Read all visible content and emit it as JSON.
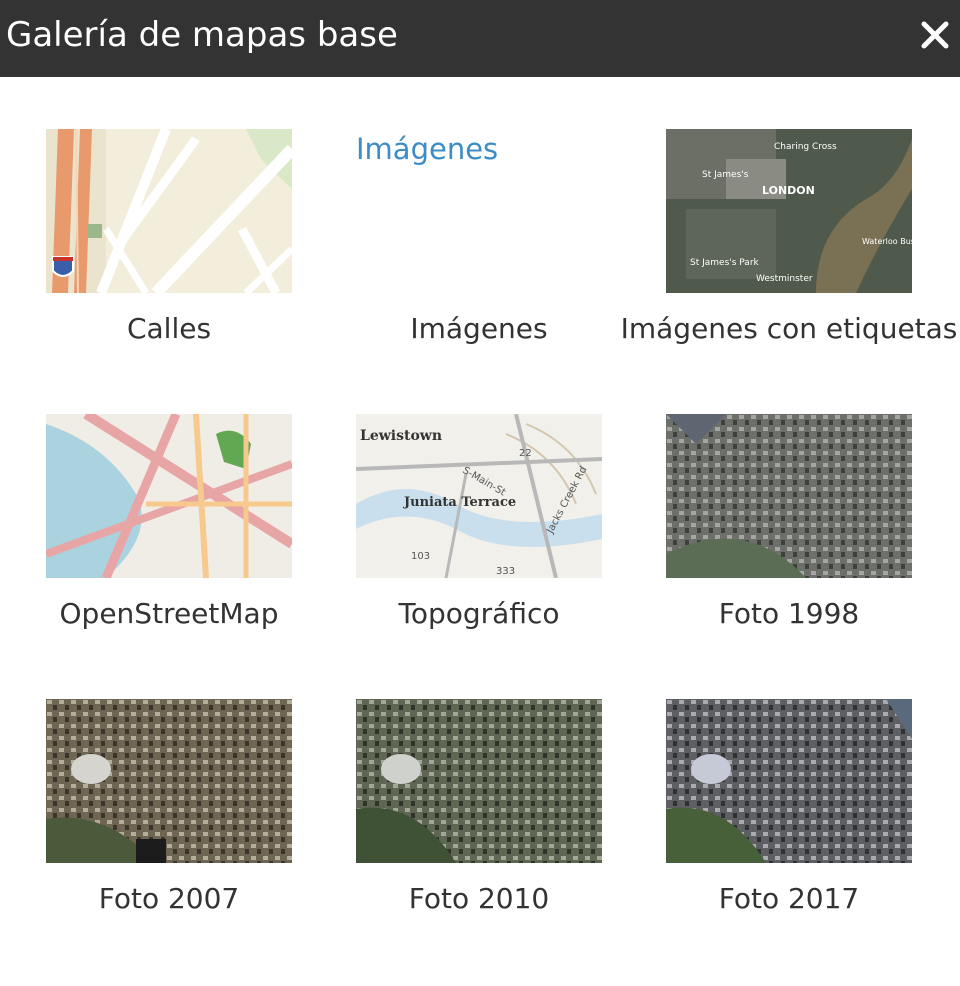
{
  "dialog": {
    "title": "Galería de mapas base",
    "close_icon": "close-icon"
  },
  "basemaps": [
    {
      "label": "Calles",
      "thumbnail": "streets-map"
    },
    {
      "label": "Imágenes",
      "thumbnail_alt": "Imágenes",
      "thumbnail_missing": true
    },
    {
      "label": "Imágenes con etiquetas",
      "thumbnail": "imagery-labels-map",
      "thumb_labels": [
        "Charing Cross",
        "St James's",
        "LONDON",
        "Waterloo Business Centre",
        "St James's Park",
        "Westminster"
      ]
    },
    {
      "label": "OpenStreetMap",
      "thumbnail": "osm-map"
    },
    {
      "label": "Topográfico",
      "thumbnail": "topo-map",
      "thumb_labels": [
        "Lewistown",
        "Juniata Terrace",
        "S-Main-St",
        "Jacks Creek Rd",
        "22",
        "103",
        "333"
      ]
    },
    {
      "label": "Foto 1998",
      "thumbnail": "aerial-1998"
    },
    {
      "label": "Foto 2007",
      "thumbnail": "aerial-2007"
    },
    {
      "label": "Foto 2010",
      "thumbnail": "aerial-2010"
    },
    {
      "label": "Foto 2017",
      "thumbnail": "aerial-2017"
    }
  ],
  "colors": {
    "header_bg": "#333333",
    "link": "#3c8dc5",
    "text": "#333333"
  }
}
